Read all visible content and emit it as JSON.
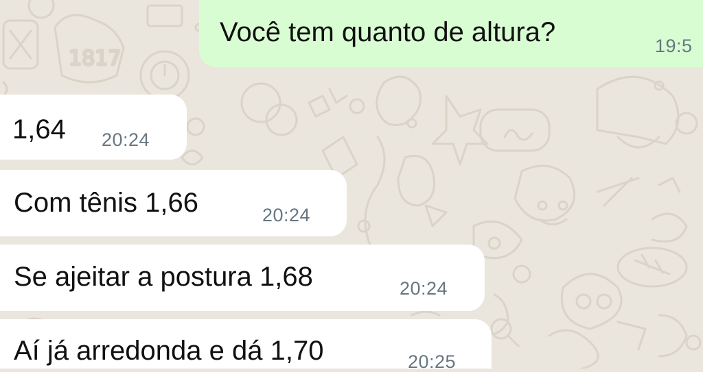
{
  "chat": {
    "background_color": "#eae5dd",
    "outgoing_bubble_color": "#d9fdd3",
    "incoming_bubble_color": "#ffffff",
    "messages": [
      {
        "direction": "outgoing",
        "text": "Você tem quanto de altura?",
        "time": "19:5"
      },
      {
        "direction": "incoming",
        "text": "1,64",
        "time": "20:24"
      },
      {
        "direction": "incoming",
        "text": "Com tênis 1,66",
        "time": "20:24"
      },
      {
        "direction": "incoming",
        "text": "Se ajeitar a postura 1,68",
        "time": "20:24"
      },
      {
        "direction": "incoming",
        "text": "Aí já arredonda e dá 1,70",
        "time": "20:25"
      }
    ]
  }
}
